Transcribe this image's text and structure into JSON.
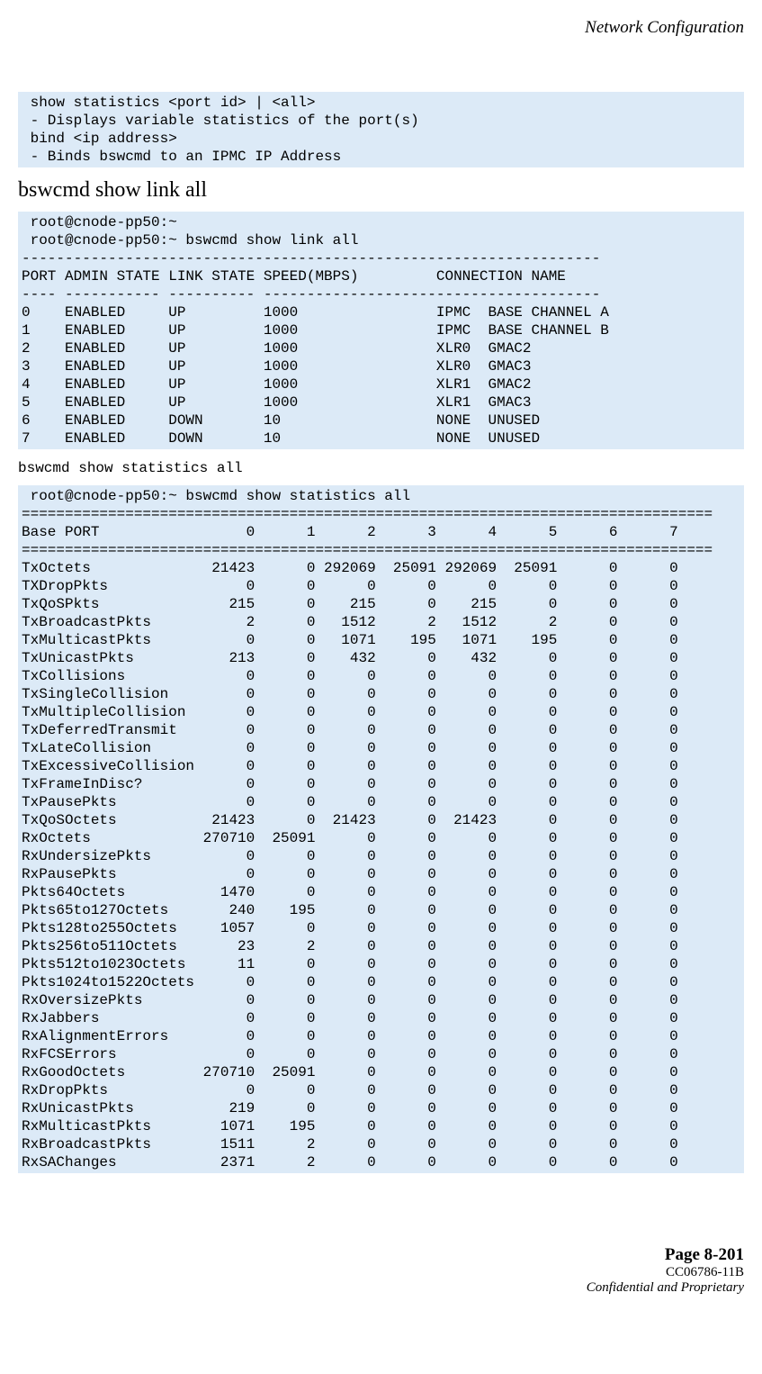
{
  "header": {
    "title": "Network Configuration"
  },
  "block1": {
    "text": " show statistics <port id> | <all>\n - Displays variable statistics of the port(s)\n bind <ip address>\n - Binds bswcmd to an IPMC IP Address"
  },
  "section1": {
    "heading": "bswcmd show link all"
  },
  "block2": {
    "text": " root@cnode-pp50:~\n root@cnode-pp50:~ bswcmd show link all\n-------------------------------------------------------------------\nPORT ADMIN STATE LINK STATE SPEED(MBPS)         CONNECTION NAME\n---- ----------- ---------- ---------------------------------------\n0    ENABLED     UP         1000                IPMC  BASE CHANNEL A\n1    ENABLED     UP         1000                IPMC  BASE CHANNEL B\n2    ENABLED     UP         1000                XLR0  GMAC2\n3    ENABLED     UP         1000                XLR0  GMAC3\n4    ENABLED     UP         1000                XLR1  GMAC2\n5    ENABLED     UP         1000                XLR1  GMAC3\n6    ENABLED     DOWN       10                  NONE  UNUSED\n7    ENABLED     DOWN       10                  NONE  UNUSED"
  },
  "section2": {
    "heading": "bswcmd show statistics all"
  },
  "block3": {
    "text": " root@cnode-pp50:~ bswcmd show statistics all\n================================================================================\nBase PORT                 0      1      2      3      4      5      6      7\n================================================================================\nTxOctets              21423      0 292069  25091 292069  25091      0      0\nTXDropPkts                0      0      0      0      0      0      0      0\nTxQoSPkts               215      0    215      0    215      0      0      0\nTxBroadcastPkts           2      0   1512      2   1512      2      0      0\nTxMulticastPkts           0      0   1071    195   1071    195      0      0\nTxUnicastPkts           213      0    432      0    432      0      0      0\nTxCollisions              0      0      0      0      0      0      0      0\nTxSingleCollision         0      0      0      0      0      0      0      0\nTxMultipleCollision       0      0      0      0      0      0      0      0\nTxDeferredTransmit        0      0      0      0      0      0      0      0\nTxLateCollision           0      0      0      0      0      0      0      0\nTxExcessiveCollision      0      0      0      0      0      0      0      0\nTxFrameInDisc?            0      0      0      0      0      0      0      0\nTxPausePkts               0      0      0      0      0      0      0      0\nTxQoSOctets           21423      0  21423      0  21423      0      0      0\nRxOctets             270710  25091      0      0      0      0      0      0\nRxUndersizePkts           0      0      0      0      0      0      0      0\nRxPausePkts               0      0      0      0      0      0      0      0\nPkts64Octets           1470      0      0      0      0      0      0      0\nPkts65to127Octets       240    195      0      0      0      0      0      0\nPkts128to255Octets     1057      0      0      0      0      0      0      0\nPkts256to511Octets       23      2      0      0      0      0      0      0\nPkts512to1023Octets      11      0      0      0      0      0      0      0\nPkts1024to1522Octets      0      0      0      0      0      0      0      0\nRxOversizePkts            0      0      0      0      0      0      0      0\nRxJabbers                 0      0      0      0      0      0      0      0\nRxAlignmentErrors         0      0      0      0      0      0      0      0\nRxFCSErrors               0      0      0      0      0      0      0      0\nRxGoodOctets         270710  25091      0      0      0      0      0      0\nRxDropPkts                0      0      0      0      0      0      0      0\nRxUnicastPkts           219      0      0      0      0      0      0      0\nRxMulticastPkts        1071    195      0      0      0      0      0      0\nRxBroadcastPkts        1511      2      0      0      0      0      0      0\nRxSAChanges            2371      2      0      0      0      0      0      0"
  },
  "footer": {
    "page": "Page 8-201",
    "doc": "CC06786-11B",
    "conf": "Confidential and Proprietary"
  }
}
